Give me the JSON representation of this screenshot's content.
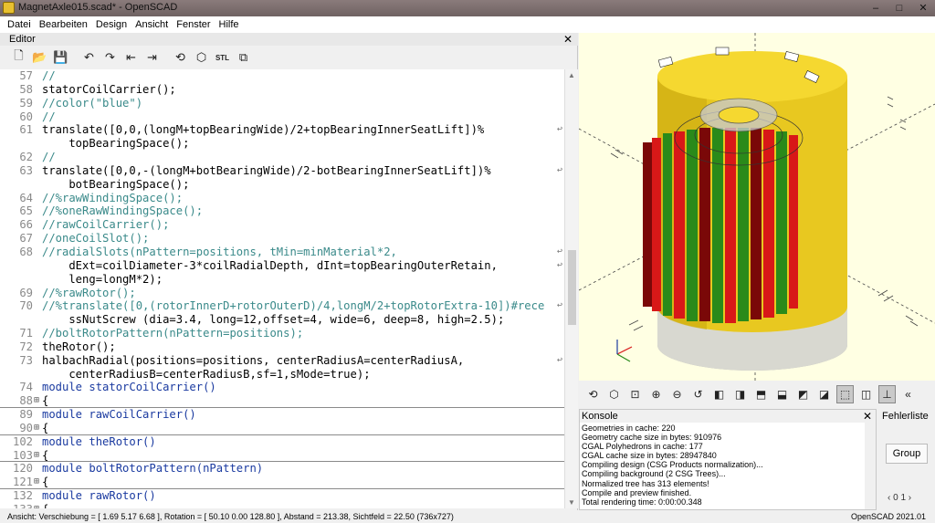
{
  "window": {
    "title": "MagnetAxle015.scad* - OpenSCAD",
    "minimize": "–",
    "maximize": "□",
    "close": "✕"
  },
  "menu": [
    "Datei",
    "Bearbeiten",
    "Design",
    "Ansicht",
    "Fenster",
    "Hilfe"
  ],
  "editor": {
    "header": "Editor",
    "close": "✕",
    "toolbar_icons": [
      "new-icon",
      "open-icon",
      "save-icon",
      "undo-icon",
      "redo-icon",
      "unindent-icon",
      "indent-icon",
      "preview-icon",
      "render-icon",
      "export-stl-icon",
      "send-to-print-icon"
    ],
    "toolbar_glyphs": {
      "new": "🗋",
      "open": "📂",
      "save": "💾",
      "undo": "↶",
      "redo": "↷",
      "unindent": "⇤",
      "indent": "⇥",
      "preview": "⟲",
      "render": "⬡",
      "stl": "STL",
      "print": "⧉"
    },
    "lines": [
      {
        "num": "57",
        "text": "//"
      },
      {
        "num": "58",
        "text": "statorCoilCarrier();"
      },
      {
        "num": "59",
        "text": "//color(\"blue\")"
      },
      {
        "num": "60",
        "text": "//"
      },
      {
        "num": "61",
        "text": "translate([0,0,(longM+topBearingWide)/2+topBearingInnerSeatLift])%",
        "wrap": "↩"
      },
      {
        "num": "",
        "text": "    topBearingSpace();"
      },
      {
        "num": "62",
        "text": "//"
      },
      {
        "num": "63",
        "text": "translate([0,0,-(longM+botBearingWide)/2-botBearingInnerSeatLift])%",
        "wrap": "↩"
      },
      {
        "num": "",
        "text": "    botBearingSpace();"
      },
      {
        "num": "64",
        "text": "//%rawWindingSpace();"
      },
      {
        "num": "65",
        "text": "//%oneRawWindingSpace();"
      },
      {
        "num": "66",
        "text": "//rawCoilCarrier();"
      },
      {
        "num": "67",
        "text": "//oneCoilSlot();"
      },
      {
        "num": "68",
        "text": "//radialSlots(nPattern=positions, tMin=minMaterial*2,",
        "wrap": "↩"
      },
      {
        "num": "",
        "text": "    dExt=coilDiameter-3*coilRadialDepth, dInt=topBearingOuterRetain,",
        "wrap": "↩"
      },
      {
        "num": "",
        "text": "    leng=longM*2);"
      },
      {
        "num": "69",
        "text": "//%rawRotor();"
      },
      {
        "num": "70",
        "text": "//%translate([0,(rotorInnerD+rotorOuterD)/4,longM/2+topRotorExtra-10])#rece",
        "wrap": "↩"
      },
      {
        "num": "",
        "text": "    ssNutScrew (dia=3.4, long=12,offset=4, wide=6, deep=8, high=2.5);"
      },
      {
        "num": "71",
        "text": "//boltRotorPattern(nPattern=positions);"
      },
      {
        "num": "72",
        "text": "theRotor();"
      },
      {
        "num": "73",
        "text": "halbachRadial(positions=positions, centerRadiusA=centerRadiusA,",
        "wrap": "↩"
      },
      {
        "num": "",
        "text": "    centerRadiusB=centerRadiusB,sf=1,sMode=true);"
      },
      {
        "num": "74",
        "text": "module statorCoilCarrier()"
      },
      {
        "num": "88",
        "fold": "⊞",
        "text": "{"
      },
      {
        "num": "89",
        "text": "module rawCoilCarrier()"
      },
      {
        "num": "90",
        "fold": "⊞",
        "text": "{"
      },
      {
        "num": "102",
        "text": "module theRotor()"
      },
      {
        "num": "103",
        "fold": "⊞",
        "text": "{"
      },
      {
        "num": "120",
        "text": "module boltRotorPattern(nPattern)"
      },
      {
        "num": "121",
        "fold": "⊞",
        "text": "{"
      },
      {
        "num": "132",
        "text": "module rawRotor()"
      },
      {
        "num": "133",
        "fold": "⊞",
        "text": "{"
      }
    ]
  },
  "viewport": {
    "colors": {
      "bg": "#ffffe3",
      "yellow": "#f0d020",
      "red": "#d81818",
      "green": "#2a8a1a",
      "darkred": "#7a0808",
      "gray": "#d8d8d0"
    },
    "axis_labels": [
      "x-axis-label",
      "y-axis-label",
      "z-axis-label"
    ]
  },
  "view_toolbar": {
    "icons": [
      "preview-icon",
      "render-icon",
      "view-all-icon",
      "zoom-in-icon",
      "zoom-out-icon",
      "reset-view-icon",
      "view-right-icon",
      "view-top-icon",
      "view-bottom-icon",
      "view-left-icon",
      "view-front-icon",
      "view-back-icon",
      "perspective-icon",
      "orthogonal-icon",
      "axes-icon"
    ],
    "glyphs": [
      "⟲",
      "⬡",
      "⊡",
      "⊕",
      "⊖",
      "↺",
      "◧",
      "◨",
      "⬒",
      "⬓",
      "◩",
      "◪",
      "⬚",
      "◫",
      "⊥"
    ],
    "more": "«"
  },
  "console": {
    "header": "Konsole",
    "close": "✕",
    "lines": [
      "Geometries in cache: 220",
      "Geometry cache size in bytes: 910976",
      "CGAL Polyhedrons in cache: 177",
      "CGAL cache size in bytes: 28947840",
      "Compiling design (CSG Products normalization)...",
      "Compiling background (2 CSG Trees)...",
      "Normalized tree has 313 elements!",
      "Compile and preview finished.",
      "Total rendering time: 0:00:00.348"
    ]
  },
  "errors": {
    "header": "Fehlerliste",
    "close": "✕",
    "group": "Group",
    "pager": "‹ 0 1 ›"
  },
  "status": {
    "left": "Ansicht: Verschiebung = [ 1.69 5.17 6.68 ], Rotation = [ 50.10 0.00 128.80 ], Abstand = 213.38, Sichtfeld = 22.50 (736x727)",
    "right": "OpenSCAD 2021.01"
  }
}
